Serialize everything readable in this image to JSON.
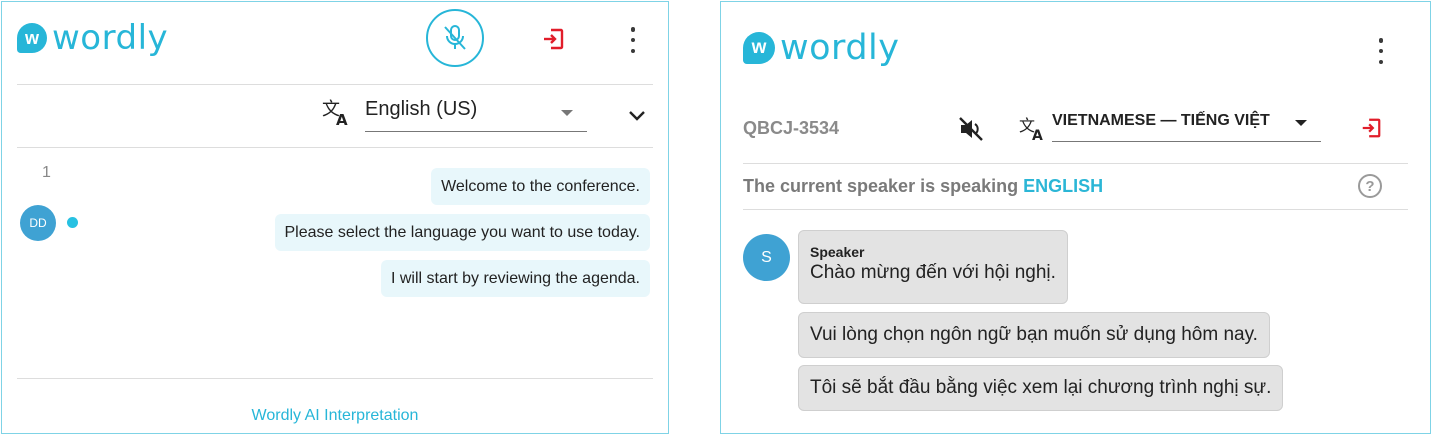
{
  "left": {
    "logo": {
      "mark": "w",
      "text": "wordly"
    },
    "icons": {
      "mic": "mic-off-icon",
      "exit": "exit-icon",
      "menu": "more-vert-icon",
      "translate": "translate-icon",
      "collapse": "chevron-down-icon"
    },
    "language": "English (US)",
    "message_number": "1",
    "avatar_initials": "DD",
    "messages": [
      "Welcome to the conference.",
      "Please select the language you want to use today.",
      "I will start by reviewing the agenda."
    ],
    "footer_link": "Wordly AI Interpretation"
  },
  "right": {
    "logo": {
      "mark": "w",
      "text": "wordly"
    },
    "icons": {
      "menu": "more-vert-icon",
      "mute": "volume-off-icon",
      "translate": "translate-icon",
      "exit": "exit-icon",
      "help": "help-circle-icon"
    },
    "room_code": "QBCJ-3534",
    "language": "VIETNAMESE — TIẾNG VIỆT",
    "speaker_prefix": "The current speaker is speaking",
    "speaker_language": "ENGLISH",
    "help_glyph": "?",
    "avatar_initial": "S",
    "speaker_name": "Speaker",
    "messages": [
      "Chào mừng đến với hội nghị.",
      "Vui lòng chọn ngôn ngữ bạn muốn sử dụng hôm nay.",
      "Tôi sẽ bắt đầu bằng việc xem lại chương trình nghị sự."
    ]
  },
  "colors": {
    "accent": "#27b6d8",
    "exit_red": "#e11d2a",
    "left_bubble": "#e8f7fb",
    "right_bubble": "#e3e3e3"
  }
}
